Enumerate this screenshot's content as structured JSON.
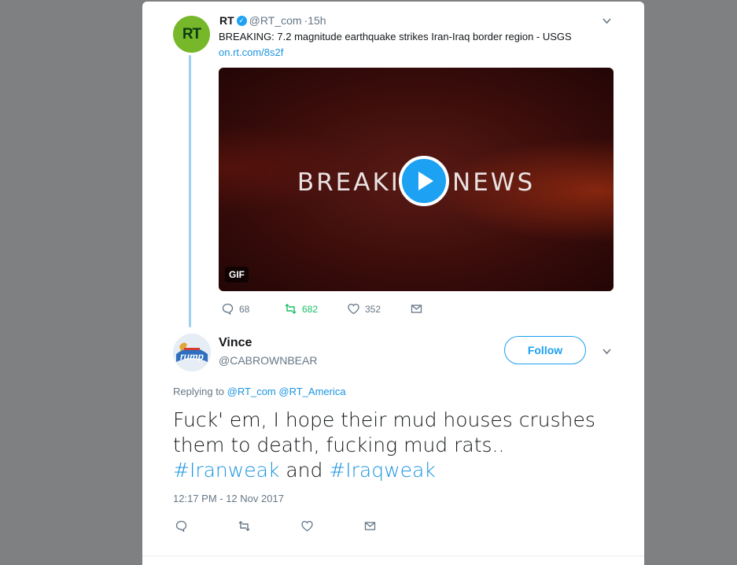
{
  "retweet": {
    "name": "RT",
    "handle": "@RT_com",
    "time": "·15h",
    "avatar_text": "RT",
    "text": "BREAKING: 7.2 magnitude earthquake strikes Iran-Iraq border region - USGS",
    "link": "on.rt.com/8s2f",
    "media": {
      "overlay_text": "BREAKING NEWS",
      "badge": "GIF"
    },
    "actions": {
      "replies": "68",
      "retweets": "682",
      "likes": "352"
    }
  },
  "reply": {
    "name": "Vince",
    "handle": "@CABROWNBEAR",
    "avatar_text": "rump",
    "follow_label": "Follow",
    "replying_prefix": "Replying to",
    "replying_to": [
      "@RT_com",
      "@RT_America"
    ],
    "text_main": "Fuck' em, I hope their  mud houses crushes them to death, fucking mud rats.. ",
    "hashtag1": "#Iranweak",
    "text_and": " and ",
    "hashtag2": "#Iraqweak",
    "timestamp": "12:17 PM - 12 Nov 2017"
  },
  "colors": {
    "accent": "#1da1f2",
    "retweet_green": "#17bf63",
    "rt_green": "#76b82a"
  }
}
